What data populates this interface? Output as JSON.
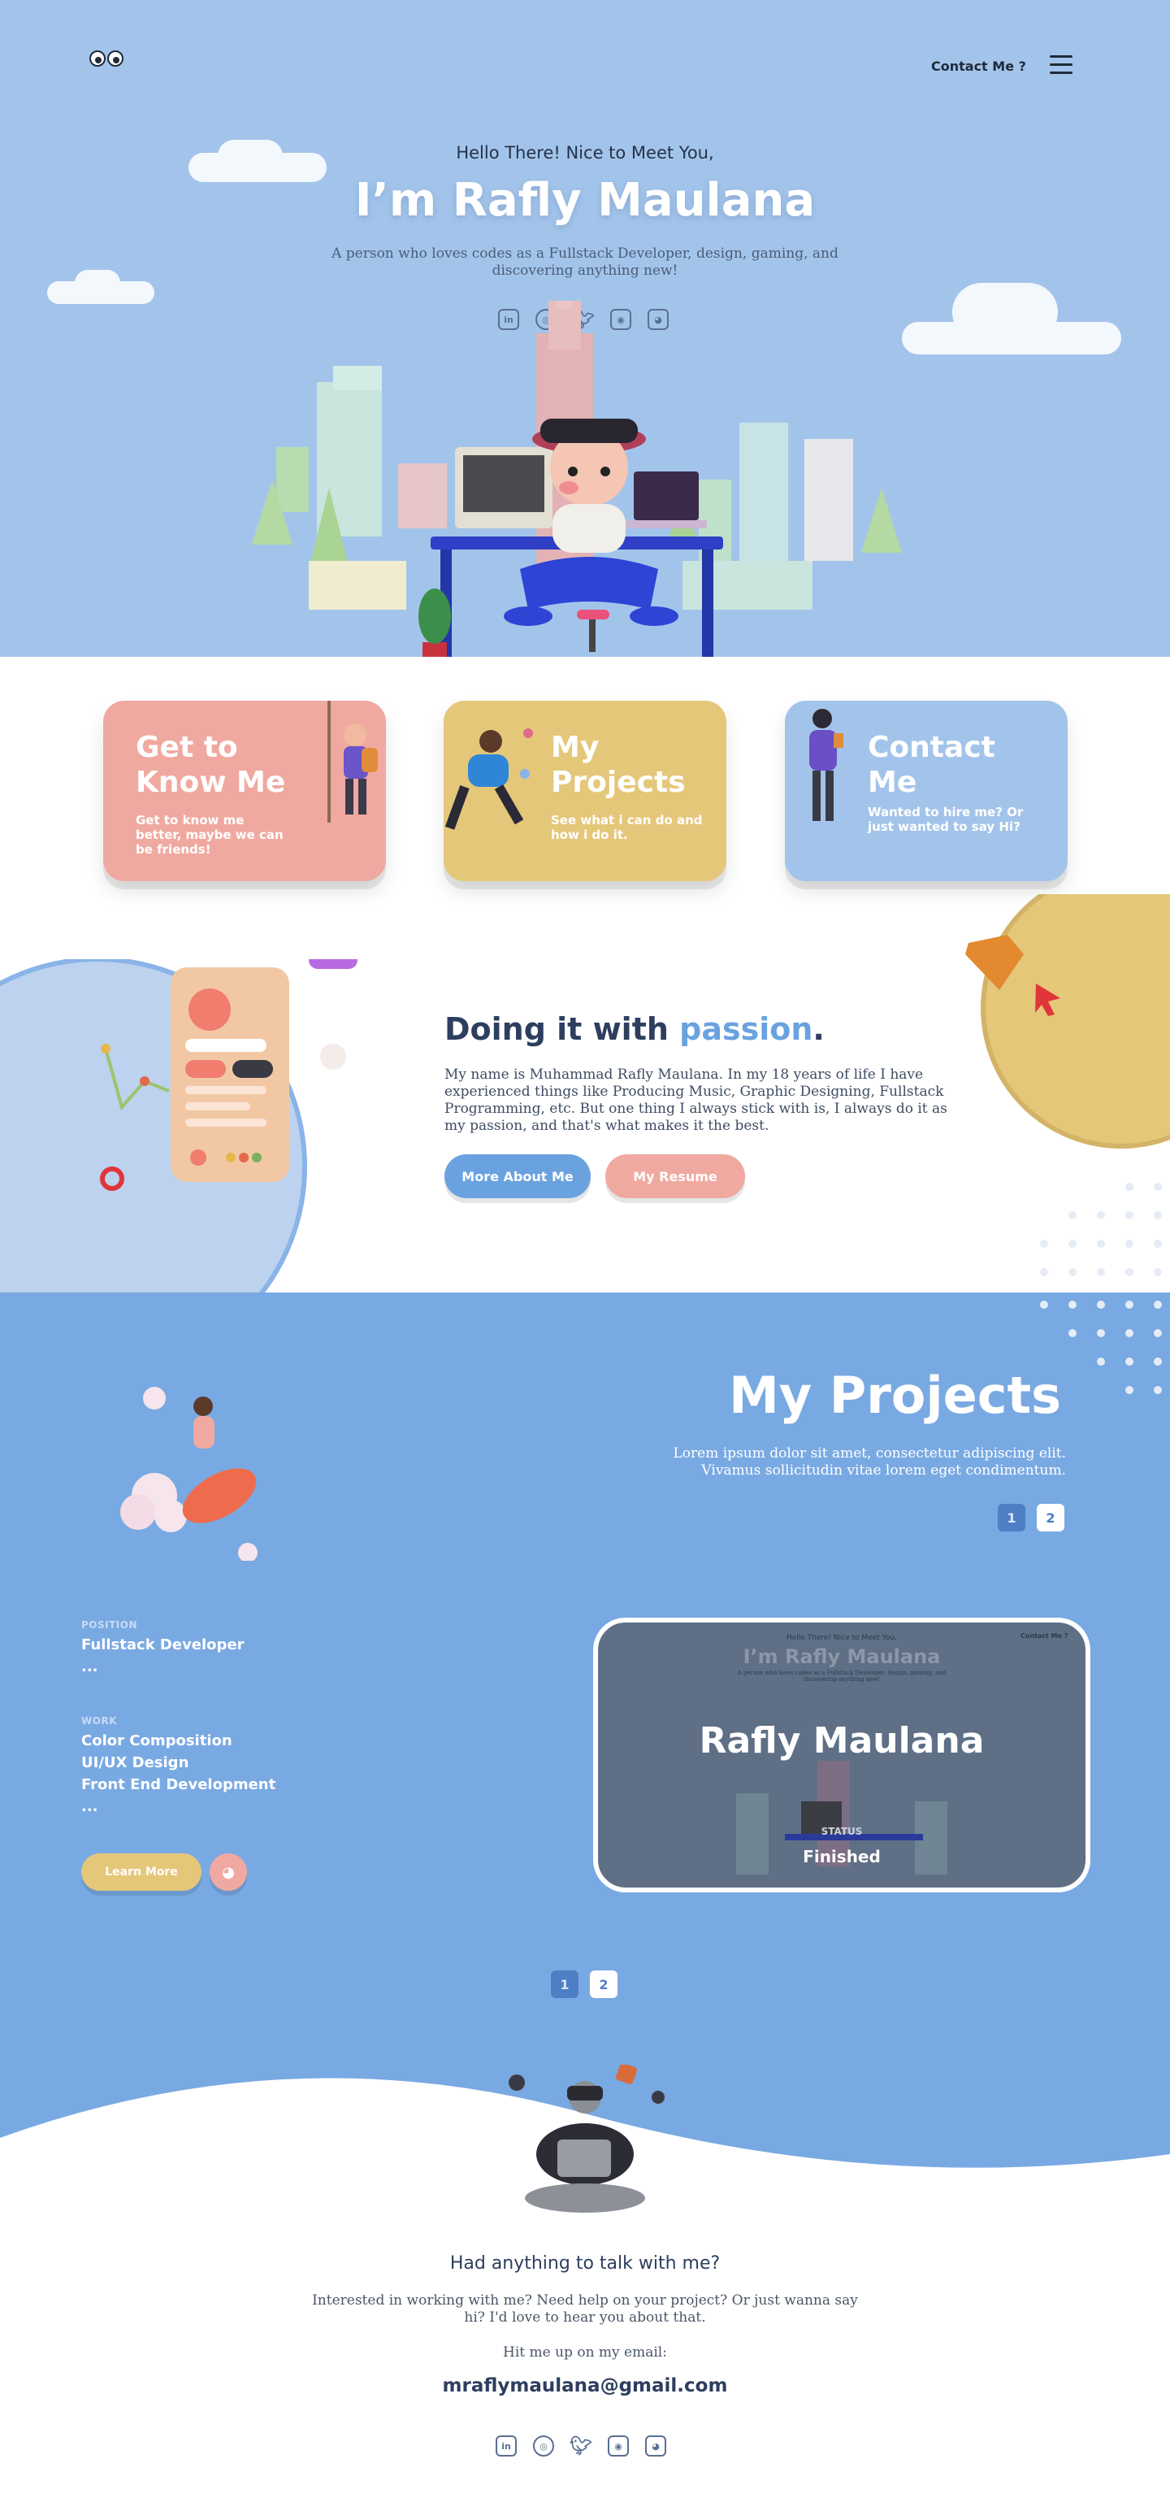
{
  "nav": {
    "contact_label": "Contact Me ?",
    "menu_icon": "hamburger-icon"
  },
  "hero": {
    "greeting": "Hello There! Nice to Meet You,",
    "name": "I’m Rafly Maulana",
    "description": "A person who loves codes as a Fullstack Developer, design, gaming, and discovering anything new!",
    "socials": [
      "linkedin-icon",
      "dribbble-icon",
      "twitter-icon",
      "instagram-icon",
      "discord-icon"
    ]
  },
  "cards": [
    {
      "title_line1": "Get to",
      "title_line2": "Know Me",
      "subtitle": "Get to know me better, maybe we can be friends!",
      "color": "#f0a9a0"
    },
    {
      "title_line1": "My",
      "title_line2": "Projects",
      "subtitle": "See what i can do and how i do it.",
      "color": "#e5c77a"
    },
    {
      "title_line1": "Contact",
      "title_line2": "Me",
      "subtitle": "Wanted to hire me? Or just wanted to say Hi?",
      "color": "#a3c4ea"
    }
  ],
  "passion": {
    "title_prefix": "Doing it with ",
    "title_highlight": "passion",
    "title_suffix": ".",
    "text": "My name is Muhammad Rafly Maulana. In my 18 years of life I have experienced things like Producing Music, Graphic Designing, Fullstack Programming, etc. But one thing I always stick with is, I always do it as my passion, and that's what makes it the best.",
    "btn_about": "More About Me",
    "btn_resume": "My Resume"
  },
  "projects": {
    "title": "My Projects",
    "description": "Lorem ipsum dolor sit amet, consectetur adipiscing elit. Vivamus sollicitudin vitae lorem eget condimentum.",
    "pages": [
      "1",
      "2"
    ],
    "position_label": "POSITION",
    "position_values": [
      "Fullstack Developer",
      "..."
    ],
    "work_label": "WORK",
    "work_values": [
      "Color Composition",
      "UI/UX Design",
      "Front End Development",
      "..."
    ],
    "learn_more": "Learn More",
    "preview_title": "Rafly Maulana",
    "preview_status_label": "STATUS",
    "preview_status": "Finished",
    "preview_greeting": "Hello There! Nice to Meet You,",
    "preview_name": "I’m Rafly Maulana",
    "preview_desc": "A person who loves codes as a Fullstack Developer, design, gaming, and discovering anything new!",
    "preview_contact": "Contact Me ?"
  },
  "contact": {
    "heading": "Had anything to talk with me?",
    "description": "Interested in working with me? Need help on your project? Or just wanna say hi? I'd love to hear you about that.",
    "hit_me": "Hit me up on my email:",
    "email": "mraflymaulana@gmail.com"
  },
  "colors": {
    "hero_bg": "#a3c4ea",
    "projects_bg": "#79a9e2",
    "accent_blue": "#6aa2e0",
    "accent_pink": "#f0a9a0",
    "accent_yellow": "#e5c77a",
    "dark_text": "#2d3e5f"
  }
}
